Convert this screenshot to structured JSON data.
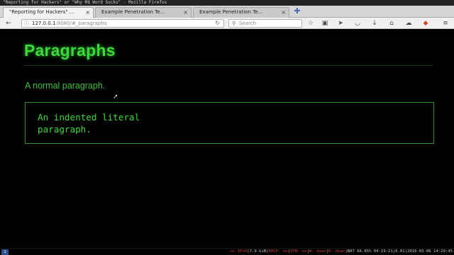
{
  "window": {
    "title": "\"Reporting for Hackers\" or \"Why M$ Word Sucks\" - Mozilla Firefox"
  },
  "tabs": [
    {
      "label": "\"Reporting for Hackers\" ..."
    },
    {
      "label": "Example Penetration Te..."
    },
    {
      "label": "Example Penetration Te..."
    }
  ],
  "nav": {
    "url_host": "127.0.0.1",
    "url_rest": ":8080/#_paragraphs",
    "search_placeholder": "Search"
  },
  "icons": {
    "back": "back-arrow-icon",
    "info": "info-icon",
    "reload": "reload-icon",
    "search": "search-icon",
    "bookmark": "star-icon",
    "reading_list": "clipboard-icon",
    "send": "send-icon",
    "pocket": "pocket-icon",
    "download": "download-icon",
    "home": "home-icon",
    "chat": "chat-icon",
    "shield": "shield-icon",
    "menu": "hamburger-menu-icon",
    "cursor": "mouse-cursor-icon"
  },
  "content": {
    "heading": "Paragraphs",
    "paragraph": "A normal paragraph.",
    "literal": "An indented literal\nparagraph."
  },
  "status": {
    "workspace": "2",
    "ipv6": "no IPv6",
    "disk": "7.9 GiB",
    "dhcp": "DHCP: no",
    "vpn": "VPN: no",
    "w": "W: down",
    "e": "E: down",
    "bat": "BAT 66.85% 04:19:21",
    "load": "0.01",
    "datetime": "2016-03-06 14:29:45"
  },
  "colors": {
    "accent_green": "#3cd83c",
    "background": "#000000",
    "status_red": "#d23a3a"
  }
}
